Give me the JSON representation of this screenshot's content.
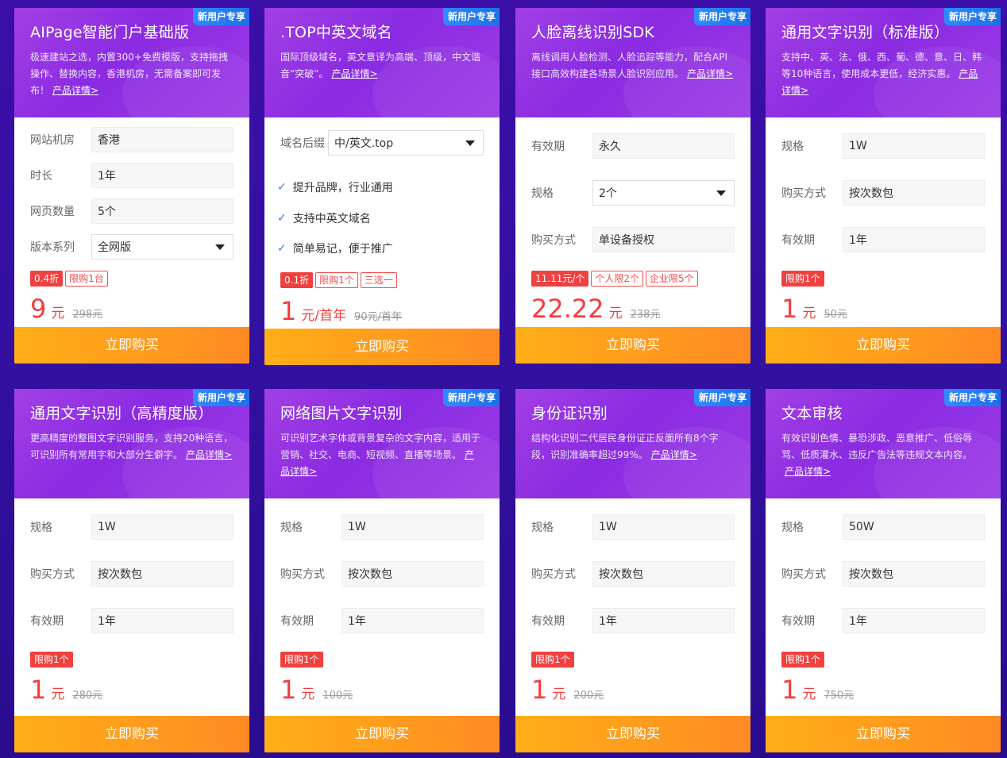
{
  "badge": "新用户专享",
  "buy_label": "立即购买",
  "cards": [
    {
      "title": "AIPage智能门户基础版",
      "desc": "极速建站之选，内置300+免费模版，支持拖拽操作、替换内容，香港机房，无需备案即可发布！",
      "link": "产品详情>",
      "fields": [
        {
          "label": "网站机房",
          "value": "香港"
        },
        {
          "label": "时长",
          "value": "1年"
        },
        {
          "label": "网页数量",
          "value": "5个"
        },
        {
          "label": "版本系列",
          "value": "全网版"
        }
      ],
      "tags": [
        "0.4折",
        "限购1台"
      ],
      "price": "9",
      "unit": "元",
      "old_price": "298元"
    },
    {
      "title": ".TOP中英文域名",
      "desc": "国际顶级域名，英文意译为高端、顶级，中文谐音“突破”。",
      "link": "产品详情>",
      "fields": [
        {
          "label": "域名后缀",
          "value": "中/英文.top"
        }
      ],
      "checks": [
        "提升品牌，行业通用",
        "支持中英文域名",
        "简单易记，便于推广"
      ],
      "tags": [
        "0.1折",
        "限购1个",
        "三选一"
      ],
      "price": "1",
      "unit": "元/首年",
      "old_price": "90元/首年"
    },
    {
      "title": "人脸离线识别SDK",
      "desc": "离线调用人脸检测、人脸追踪等能力，配合API接口高效构建各场景人脸识别应用。",
      "link": "产品详情>",
      "fields": [
        {
          "label": "有效期",
          "value": "永久"
        },
        {
          "label": "规格",
          "value": "2个"
        },
        {
          "label": "购买方式",
          "value": "单设备授权"
        }
      ],
      "tags": [
        "11.11元/个",
        "个人限2个",
        "企业限5个"
      ],
      "price": "22.22",
      "unit": "元",
      "old_price": "238元"
    },
    {
      "title": "通用文字识别（标准版）",
      "desc": "支持中、英、法、俄、西、葡、德、意、日、韩等10种语言，使用成本更低，经济实惠。",
      "link": "产品详情>",
      "fields": [
        {
          "label": "规格",
          "value": "1W"
        },
        {
          "label": "购买方式",
          "value": "按次数包"
        },
        {
          "label": "有效期",
          "value": "1年"
        }
      ],
      "tags": [
        "限购1个"
      ],
      "price": "1",
      "unit": "元",
      "old_price": "50元"
    },
    {
      "title": "通用文字识别（高精度版）",
      "desc": "更高精度的整图文字识别服务，支持20种语言，可识别所有常用字和大部分生僻字。",
      "link": "产品详情>",
      "fields": [
        {
          "label": "规格",
          "value": "1W"
        },
        {
          "label": "购买方式",
          "value": "按次数包"
        },
        {
          "label": "有效期",
          "value": "1年"
        }
      ],
      "tags": [
        "限购1个"
      ],
      "price": "1",
      "unit": "元",
      "old_price": "280元"
    },
    {
      "title": "网络图片文字识别",
      "desc": "可识别艺术字体或背景复杂的文字内容，适用于营销、社交、电商、短视频、直播等场景。",
      "link": "产品详情>",
      "fields": [
        {
          "label": "规格",
          "value": "1W"
        },
        {
          "label": "购买方式",
          "value": "按次数包"
        },
        {
          "label": "有效期",
          "value": "1年"
        }
      ],
      "tags": [
        "限购1个"
      ],
      "price": "1",
      "unit": "元",
      "old_price": "100元"
    },
    {
      "title": "身份证识别",
      "desc": "结构化识别二代居民身份证正反面所有8个字段，识别准确率超过99%。",
      "link": "产品详情>",
      "fields": [
        {
          "label": "规格",
          "value": "1W"
        },
        {
          "label": "购买方式",
          "value": "按次数包"
        },
        {
          "label": "有效期",
          "value": "1年"
        }
      ],
      "tags": [
        "限购1个"
      ],
      "price": "1",
      "unit": "元",
      "old_price": "200元"
    },
    {
      "title": "文本审核",
      "desc": "有效识别色情、暴恐涉政、恶意推广、低俗辱骂、低质灌水、违反广告法等违规文本内容。",
      "link": "产品详情>",
      "fields": [
        {
          "label": "规格",
          "value": "50W"
        },
        {
          "label": "购买方式",
          "value": "按次数包"
        },
        {
          "label": "有效期",
          "value": "1年"
        }
      ],
      "tags": [
        "限购1个"
      ],
      "price": "1",
      "unit": "元",
      "old_price": "750元"
    }
  ]
}
